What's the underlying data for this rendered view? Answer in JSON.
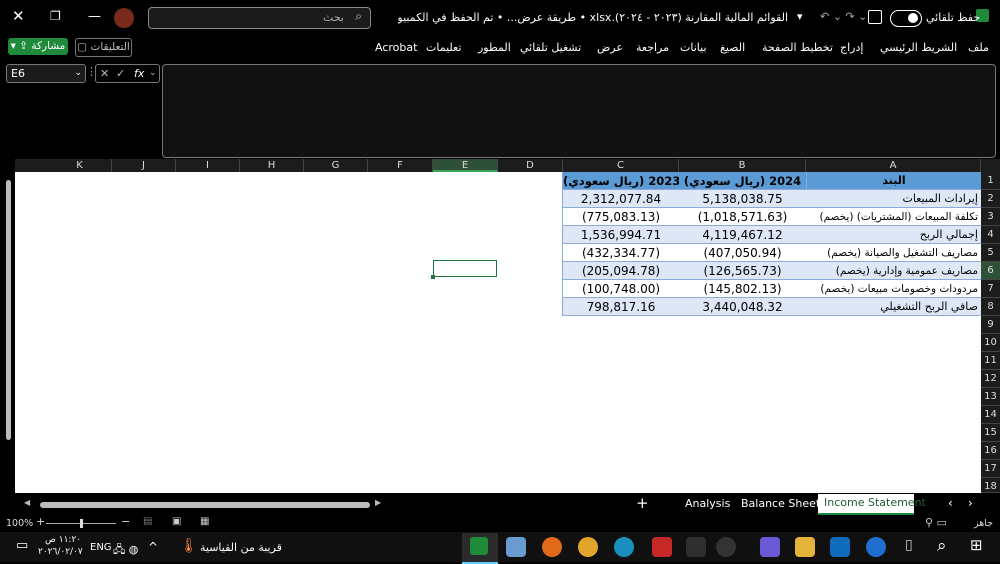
{
  "titlebar": {
    "autosave_label": "حفظ تلقائي",
    "doc_title": "القوائم المالية المقارنة (٢٠٢٣ - ٢٠٢٤).xlsx • طريقة عرض... • تم الحفظ في الكمبيوتر الشخصي هذا ▾",
    "search_placeholder": "بحث"
  },
  "ribbon": {
    "tabs": [
      "ملف",
      "الشريط الرئيسي",
      "إدراج",
      "تخطيط الصفحة",
      "الصيغ",
      "بيانات",
      "مراجعة",
      "عرض",
      "تشغيل تلقائي",
      "المطور",
      "تعليمات",
      "Acrobat"
    ],
    "share_label": "مشاركة",
    "comments_label": "التعليقات"
  },
  "formula_bar": {
    "name_box": "E6",
    "fx_label": "fx",
    "content": ""
  },
  "columns": [
    "A",
    "B",
    "C",
    "D",
    "E",
    "F",
    "G",
    "H",
    "I",
    "J",
    "K"
  ],
  "rows": [
    "1",
    "2",
    "3",
    "4",
    "5",
    "6",
    "7",
    "8",
    "9",
    "10",
    "11",
    "12",
    "13",
    "14",
    "15",
    "16",
    "17",
    "18"
  ],
  "table": {
    "headers": [
      "البند",
      "(ريال سعودي) 2024",
      "(ريال سعودي) 2023"
    ],
    "rows": [
      [
        "إيرادات المبيعات",
        "5,138,038.75",
        "2,312,077.84"
      ],
      [
        "(يخصم) تكلفة المبيعات (المشتريات)",
        "(1,018,571.63)",
        "(775,083.13)"
      ],
      [
        "إجمالي الربح",
        "4,119,467.12",
        "1,536,994.71"
      ],
      [
        "(يخصم) مصاريف التشغيل والصيانة",
        "(407,050.94)",
        "(432,334.77)"
      ],
      [
        "(يخصم) مصاريف عمومية وإدارية",
        "(126,565.73)",
        "(205,094.78)"
      ],
      [
        "(يخصم) مردودات وخصومات مبيعات",
        "(145,802.13)",
        "(100,748.00)"
      ],
      [
        "صافي الربح التشغيلي",
        "3,440,048.32",
        "798,817.16"
      ]
    ]
  },
  "sheet_tabs": [
    "Income Statement",
    "Balance Sheet",
    "Analysis"
  ],
  "active_sheet": "Income Statement",
  "status": {
    "ready": "جاهز",
    "zoom": "100%"
  },
  "taskbar": {
    "weather": "قريبة من القياسية",
    "lang": "ENG",
    "time": "١١:٢٠ ص",
    "date": "٢٠٢٦/٠٢/٠٧"
  },
  "colors": {
    "header_fill": "#5b9bd5",
    "band_fill": "#dde7f6",
    "accent_green": "#1e8a3a"
  }
}
